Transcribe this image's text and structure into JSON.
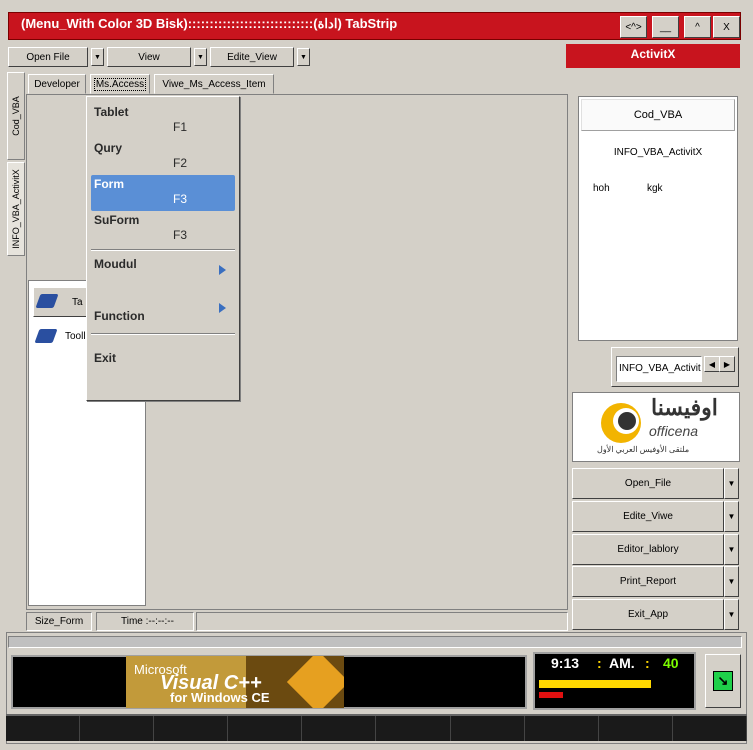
{
  "window": {
    "title": "(Menu_With Color 3D Bisk):::::::::::::::::::::::::::::(اداة) TabStrip",
    "buttons": [
      "<^>",
      "__",
      "^",
      "X"
    ]
  },
  "menubar": {
    "open_file": "Open File",
    "view": "View",
    "edite_view": "Edite_View",
    "activitx": "ActivitX"
  },
  "tabs": [
    "Developer",
    "Ms.Access",
    "Viwe_Ms_Access_Item"
  ],
  "vertical_tabs": [
    "Cod_VBA",
    "INFO_VBA_ActivitX"
  ],
  "dropdown_menu": {
    "items": [
      {
        "label": "Tablet",
        "key": "F1"
      },
      {
        "label": "Qury",
        "key": "F2"
      },
      {
        "label": "Form",
        "key": "F3"
      },
      {
        "label": "SuForm",
        "key": "F3"
      }
    ],
    "submenus": [
      "Moudul",
      "Function"
    ],
    "exit": "Exit"
  },
  "tree_items": [
    "Ta",
    "Tooll"
  ],
  "right_panel": {
    "header": "Cod_VBA",
    "info": "INFO_VBA_ActivitX",
    "col1": "hoh",
    "col2": "kgk",
    "scroll_label": "INFO_VBA_Activit"
  },
  "logo": {
    "arabic_name": "اوفيسنا",
    "latin_name": "officena",
    "tagline": "ملتقى الأوفيس العربي الأول"
  },
  "side_buttons": [
    "Open_File",
    "Edite_Viwe",
    "Editor_lablory",
    "Print_Report",
    "Exit_App"
  ],
  "status": {
    "size_form": "Size_Form",
    "time": "Time :--:--:--"
  },
  "banner": {
    "line1": "Microsoft",
    "line2": "Visual C++",
    "line3": "for Windows CE"
  },
  "clock": {
    "time": "9:13",
    "ampm": "AM.",
    "seconds": "40"
  },
  "colors": {
    "title_red": "#c8141e",
    "menu_highlight": "#5a8fd6",
    "clock_yellow": "#ffd800",
    "clock_green": "#7cfc00"
  }
}
